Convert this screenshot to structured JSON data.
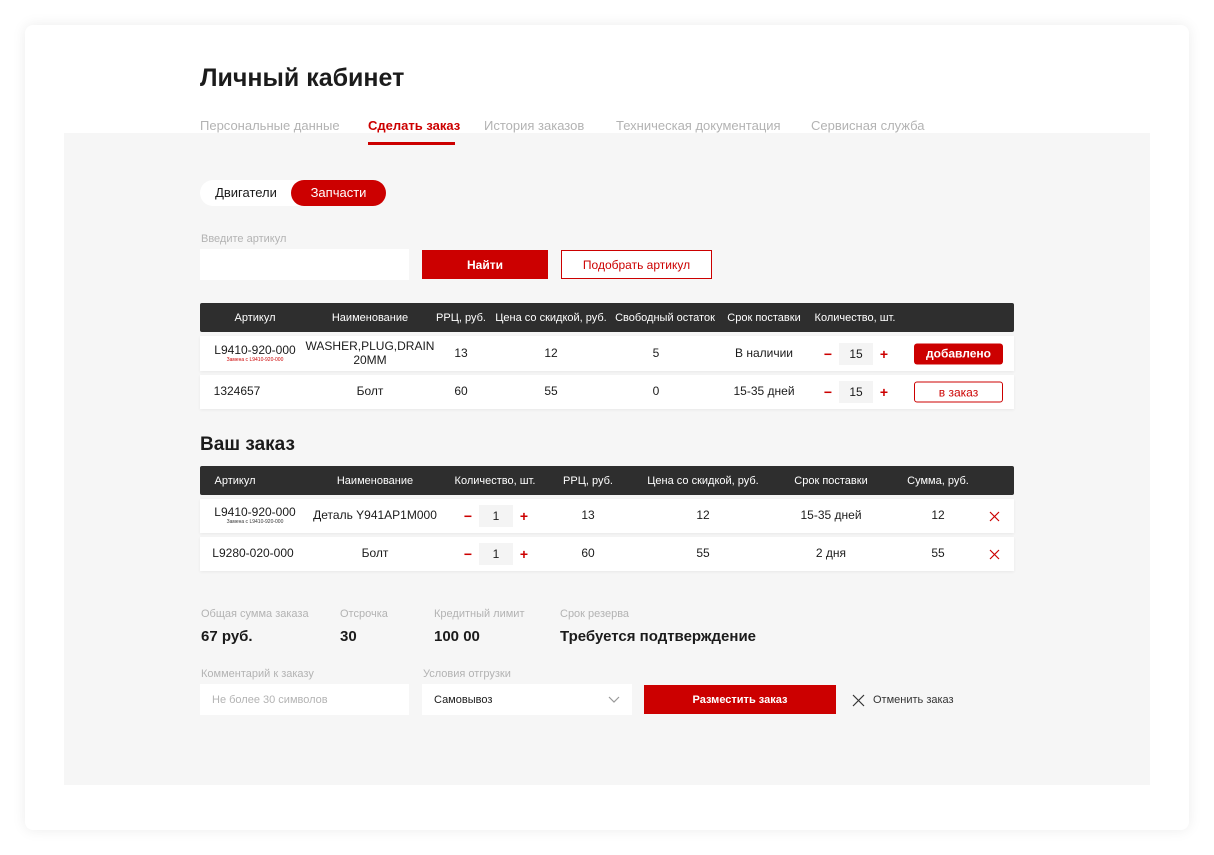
{
  "page_title": "Личный кабинет",
  "tabs": [
    {
      "label": "Персональные данные"
    },
    {
      "label": "Сделать заказ"
    },
    {
      "label": "История заказов"
    },
    {
      "label": "Техническая документация"
    },
    {
      "label": "Сервисная служба"
    }
  ],
  "active_tab": "Сделать заказ",
  "toggle": {
    "option_1": "Двигатели",
    "option_2": "Запчасти",
    "selected": "Запчасти"
  },
  "search": {
    "label": "Введите артикул",
    "value": "",
    "find_button": "Найти",
    "pick_button": "Подобрать артикул"
  },
  "results_table": {
    "headers": [
      "Артикул",
      "Наименование",
      "РРЦ, руб.",
      "Цена со скидкой, руб.",
      "Свободный остаток",
      "Срок  поставки",
      "Количество, шт."
    ],
    "rows": [
      {
        "article": "L9410-920-000",
        "replacement": "Замена с L9410-920-000",
        "name": "WASHER,PLUG,DRAIN 20MM",
        "rrp": "13",
        "discount_price": "12",
        "stock": "5",
        "delivery": "В наличии",
        "qty": "15",
        "action": "добавлено"
      },
      {
        "article": "1324657",
        "replacement": "",
        "name": "Болт",
        "rrp": "60",
        "discount_price": "55",
        "stock": "0",
        "delivery": "15-35 дней",
        "qty": "15",
        "action": "в заказ"
      }
    ]
  },
  "order": {
    "title": "Ваш заказ",
    "headers": [
      "Артикул",
      "Наименование",
      "Количество, шт.",
      "РРЦ, руб.",
      "Цена со скидкой, руб.",
      "Срок поставки",
      "Сумма, руб."
    ],
    "rows": [
      {
        "article": "L9410-920-000",
        "replacement": "Замена с L9410-920-000",
        "name": "Деталь Y941AP1M000",
        "qty": "1",
        "rrp": "13",
        "discount_price": "12",
        "delivery": "15-35 дней",
        "sum": "12"
      },
      {
        "article": "L9280-020-000",
        "replacement": "",
        "name": "Болт",
        "qty": "1",
        "rrp": "60",
        "discount_price": "55",
        "delivery": "2 дня",
        "sum": "55"
      }
    ]
  },
  "summary": {
    "total": {
      "label": "Общая сумма заказа",
      "value": "67 руб."
    },
    "deferral": {
      "label": "Отсрочка",
      "value": "30"
    },
    "credit": {
      "label": "Кредитный лимит",
      "value": "100 00"
    },
    "reserve": {
      "label": "Срок резерва",
      "value": "Требуется подтверждение"
    }
  },
  "comment": {
    "label": "Комментарий к заказу",
    "placeholder": "Не более 30 символов"
  },
  "shipping": {
    "label": "Условия отгрузки",
    "value": "Самовывоз"
  },
  "place_order_button": "Разместить заказ",
  "cancel_order": "Отменить заказ",
  "colors": {
    "accent": "#cc0000",
    "header_dark": "#2e2e2e",
    "background_grey": "#f6f6f6"
  }
}
